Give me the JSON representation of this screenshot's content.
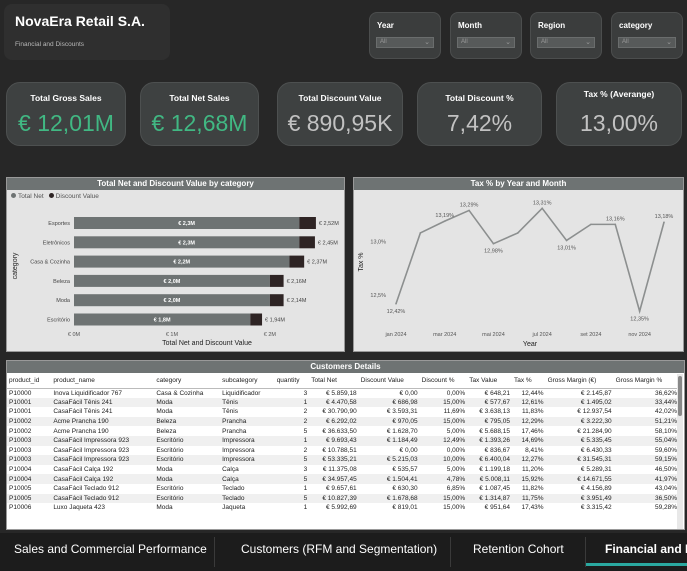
{
  "brand": {
    "title": "NovaEra Retail S.A.",
    "subtitle": "Financial and Discounts"
  },
  "slicers": [
    {
      "label": "Year",
      "value": "All"
    },
    {
      "label": "Month",
      "value": "All"
    },
    {
      "label": "Region",
      "value": "All"
    },
    {
      "label": "category",
      "value": "All"
    }
  ],
  "kpis": [
    {
      "title": "Total Gross Sales",
      "value": "€ 12,01M",
      "color": "#41b883"
    },
    {
      "title": "Total Net Sales",
      "value": "€ 12,68M",
      "color": "#41b883"
    },
    {
      "title": "Total Discount Value",
      "value": "€ 890,95K",
      "color": "#c2c2c2"
    },
    {
      "title": "Total Discount %",
      "value": "7,42%",
      "color": "#c2c2c2"
    },
    {
      "title": "Tax % (Averange)",
      "value": "13,00%",
      "color": "#c2c2c2"
    }
  ],
  "bar_chart_labels": {
    "title": "Total Net and Discount Value by category",
    "legend_net": "Total Net",
    "legend_discount": "Discount Value",
    "ylabel": "category",
    "xlabel": "Total Net and Discount Value",
    "ticks": [
      "€ 0M",
      "€ 1M",
      "€ 2M"
    ]
  },
  "line_chart_labels": {
    "title": "Tax % by Year and Month",
    "ylabel": "Tax %",
    "xlabel": "Year",
    "yticks": [
      "13,0%",
      "12,5%"
    ],
    "xticks": [
      "jan 2024",
      "mar 2024",
      "mai 2024",
      "jul 2024",
      "set 2024",
      "nov 2024"
    ]
  },
  "chart_data": [
    {
      "type": "bar",
      "title": "Total Net and Discount Value by category",
      "xlabel": "Total Net and Discount Value",
      "ylabel": "category",
      "xlim": [
        0,
        2.6
      ],
      "stacked": true,
      "orientation": "horizontal",
      "legend": "top-left",
      "categories": [
        "Esportes",
        "Eletrônicos",
        "Casa & Cozinha",
        "Beleza",
        "Moda",
        "Escritório"
      ],
      "series": [
        {
          "name": "Total Net",
          "color": "#6e7373",
          "values": [
            2.3,
            2.3,
            2.2,
            2.0,
            2.0,
            1.8
          ],
          "labels": [
            "€ 2,3M",
            "€ 2,3M",
            "€ 2,2M",
            "€ 2,0M",
            "€ 2,0M",
            "€ 1,8M"
          ]
        },
        {
          "name": "Discount Value",
          "color": "#2e2424",
          "values": [
            0.17,
            0.16,
            0.15,
            0.14,
            0.14,
            0.12
          ]
        }
      ],
      "totals": [
        2.52,
        2.45,
        2.37,
        2.16,
        2.14,
        1.94
      ],
      "total_labels": [
        "€ 2,52M",
        "€ 2,45M",
        "€ 2,37M",
        "€ 2,16M",
        "€ 2,14M",
        "€ 1,94M"
      ]
    },
    {
      "type": "line",
      "title": "Tax % by Year and Month",
      "xlabel": "Year",
      "ylabel": "Tax %",
      "ylim": [
        12.25,
        13.35
      ],
      "x": [
        "jan 2024",
        "fev 2024",
        "mar 2024",
        "abr 2024",
        "mai 2024",
        "jun 2024",
        "jul 2024",
        "ago 2024",
        "set 2024",
        "out 2024",
        "nov 2024",
        "dez 2024"
      ],
      "series": [
        {
          "name": "Tax %",
          "color": "#8c8f8f",
          "values": [
            12.42,
            13.08,
            13.19,
            13.29,
            12.98,
            13.08,
            13.31,
            13.01,
            13.16,
            13.16,
            12.35,
            13.18
          ],
          "labels": [
            "12,42%",
            "",
            "13,19%",
            "13,29%",
            "12,98%",
            "",
            "13,31%",
            "13,01%",
            "",
            "13,16%",
            "12,35%",
            "13,18%"
          ]
        }
      ]
    }
  ],
  "table": {
    "title": "Customers Details",
    "columns": [
      "product_id",
      "product_name",
      "category",
      "subcategory",
      "quantity",
      "Total Net",
      "Discount Value",
      "Discount %",
      "Tax Value",
      "Tax %",
      "Gross Margin (€)",
      "Gross Margin %"
    ],
    "rows": [
      [
        "P10000",
        "Inova Liquidificador 767",
        "Casa & Cozinha",
        "Liquidificador",
        "3",
        "€ 5.859,18",
        "€ 0,00",
        "0,00%",
        "€ 648,21",
        "12,44%",
        "€ 2.145,87",
        "36,62%"
      ],
      [
        "P10001",
        "CasaFácil Tênis 241",
        "Moda",
        "Tênis",
        "1",
        "€ 4.470,58",
        "€ 686,98",
        "15,00%",
        "€ 577,67",
        "12,61%",
        "€ 1.495,02",
        "33,44%"
      ],
      [
        "P10001",
        "CasaFácil Tênis 241",
        "Moda",
        "Tênis",
        "2",
        "€ 30.790,90",
        "€ 3.593,31",
        "11,69%",
        "€ 3.638,13",
        "11,83%",
        "€ 12.937,54",
        "42,02%"
      ],
      [
        "P10002",
        "Acme Prancha 190",
        "Beleza",
        "Prancha",
        "2",
        "€ 6.292,02",
        "€ 970,05",
        "15,00%",
        "€ 795,05",
        "12,29%",
        "€ 3.222,30",
        "51,21%"
      ],
      [
        "P10002",
        "Acme Prancha 190",
        "Beleza",
        "Prancha",
        "5",
        "€ 36.633,50",
        "€ 1.628,70",
        "5,00%",
        "€ 5.688,15",
        "17,46%",
        "€ 21.284,90",
        "58,10%"
      ],
      [
        "P10003",
        "CasaFácil Impressora 923",
        "Escritório",
        "Impressora",
        "1",
        "€ 9.693,43",
        "€ 1.184,49",
        "12,49%",
        "€ 1.393,26",
        "14,69%",
        "€ 5.335,45",
        "55,04%"
      ],
      [
        "P10003",
        "CasaFácil Impressora 923",
        "Escritório",
        "Impressora",
        "2",
        "€ 10.788,51",
        "€ 0,00",
        "0,00%",
        "€ 836,67",
        "8,41%",
        "€ 6.430,33",
        "59,60%"
      ],
      [
        "P10003",
        "CasaFácil Impressora 923",
        "Escritório",
        "Impressora",
        "5",
        "€ 53.335,21",
        "€ 5.215,03",
        "10,00%",
        "€ 6.400,04",
        "12,27%",
        "€ 31.545,31",
        "59,15%"
      ],
      [
        "P10004",
        "CasaFácil Calça 192",
        "Moda",
        "Calça",
        "3",
        "€ 11.375,08",
        "€ 535,57",
        "5,00%",
        "€ 1.199,18",
        "11,20%",
        "€ 5.289,31",
        "46,50%"
      ],
      [
        "P10004",
        "CasaFácil Calça 192",
        "Moda",
        "Calça",
        "5",
        "€ 34.957,45",
        "€ 1.504,41",
        "4,78%",
        "€ 5.008,11",
        "15,92%",
        "€ 14.671,55",
        "41,97%"
      ],
      [
        "P10005",
        "CasaFácil Teclado 912",
        "Escritório",
        "Teclado",
        "1",
        "€ 9.657,61",
        "€ 630,30",
        "6,85%",
        "€ 1.087,45",
        "11,82%",
        "€ 4.156,89",
        "43,04%"
      ],
      [
        "P10005",
        "CasaFácil Teclado 912",
        "Escritório",
        "Teclado",
        "5",
        "€ 10.827,39",
        "€ 1.678,68",
        "15,00%",
        "€ 1.314,87",
        "11,75%",
        "€ 3.951,49",
        "36,50%"
      ],
      [
        "P10006",
        "Luxo Jaqueta 423",
        "Moda",
        "Jaqueta",
        "1",
        "€ 5.992,69",
        "€ 819,01",
        "15,00%",
        "€ 951,64",
        "17,43%",
        "€ 3.315,42",
        "59,28%"
      ]
    ]
  },
  "tabs": [
    {
      "label": "Sales and Commercial Performance",
      "active": false
    },
    {
      "label": "Customers (RFM and Segmentation)",
      "active": false
    },
    {
      "label": "Retention Cohort",
      "active": false
    },
    {
      "label": "Financial and D",
      "active": true
    }
  ]
}
